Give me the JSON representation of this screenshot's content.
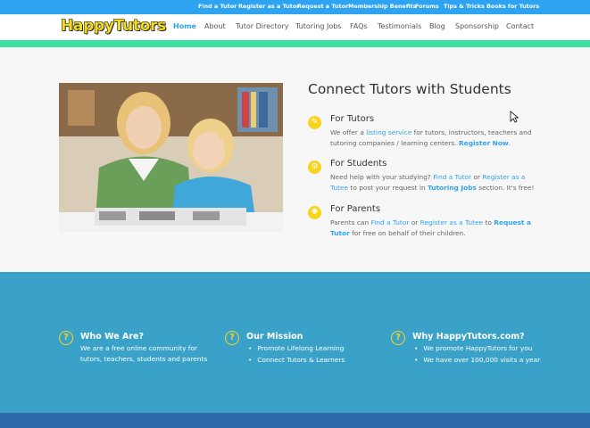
{
  "topbar": {
    "links": [
      "Find a Tutor",
      "Register as a Tutor",
      "Request a Tutor",
      "Membership Benefits",
      "Forums",
      "Tips & Tricks",
      "Books for Tutors"
    ]
  },
  "header": {
    "logo": "HappyTutors",
    "nav": [
      "Home",
      "About",
      "Tutor Directory",
      "Tutoring Jobs",
      "FAQs",
      "Testimonials",
      "Blog",
      "Sponsorship",
      "Contact"
    ]
  },
  "hero": {
    "title": "Connect Tutors with Students",
    "features": [
      {
        "icon": "graduation-icon",
        "title": "For Tutors",
        "t1": "We offer a ",
        "l1": "listing service",
        "t2": " for tutors, instructors, teachers and tutoring companies / learning centers. ",
        "l2": "Register Now",
        "t3": "."
      },
      {
        "icon": "gear-icon",
        "title": "For Students",
        "t1": "Need help with your studying? ",
        "l1": "Find a Tutor",
        "t2": " or ",
        "l2": "Register as a Tutee",
        "t3": " to post your request in ",
        "l3": "Tutoring Jobs",
        "t4": " section. It's free!"
      },
      {
        "icon": "lifebuoy-icon",
        "title": "For Parents",
        "t1": "Parents can ",
        "l1": "Find a Tutor",
        "t2": " or ",
        "l2": "Register as a Tutee",
        "t3": " to ",
        "l3": "Request a Tutor",
        "t4": " for free on behalf of their children."
      }
    ]
  },
  "footer": {
    "columns": [
      {
        "title": "Who We Are?",
        "text": "We are a free online community for tutors, teachers, students and parents"
      },
      {
        "title": "Our Mission",
        "items": [
          "Promote Lifelong Learning",
          "Connect Tutors & Learners"
        ]
      },
      {
        "title": "Why HappyTutors.com?",
        "items": [
          "We promote HappyTutors for you",
          "We have over 100,000 visits a year"
        ]
      }
    ]
  },
  "colors": {
    "accent": "#2ea3f2",
    "green": "#3ddfa3",
    "footer": "#3aa2c9",
    "yellow": "#f7d51f"
  }
}
